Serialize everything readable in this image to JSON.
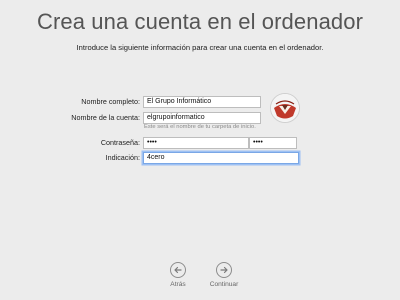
{
  "header": {
    "title": "Crea una cuenta en el ordenador",
    "subtitle": "Introduce la siguiente información para crear una cuenta en el ordenador."
  },
  "form": {
    "full_name_label": "Nombre completo:",
    "full_name_value": "El Grupo Informático",
    "account_name_label": "Nombre de la cuenta:",
    "account_name_value": "elgrupoinformatico",
    "account_hint": "Este será el nombre de tu carpeta de inicio.",
    "password_label": "Contraseña:",
    "password_value": "••••",
    "password_verify_value": "••••",
    "hint_label": "Indicación:",
    "hint_value": "4cero"
  },
  "avatar": {
    "icon": "user-avatar-picture"
  },
  "footer": {
    "back_label": "Atrás",
    "continue_label": "Continuar"
  },
  "colors": {
    "background": "#ececec",
    "focus_ring": "#9ec1f3",
    "avatar_red": "#c0392b"
  }
}
